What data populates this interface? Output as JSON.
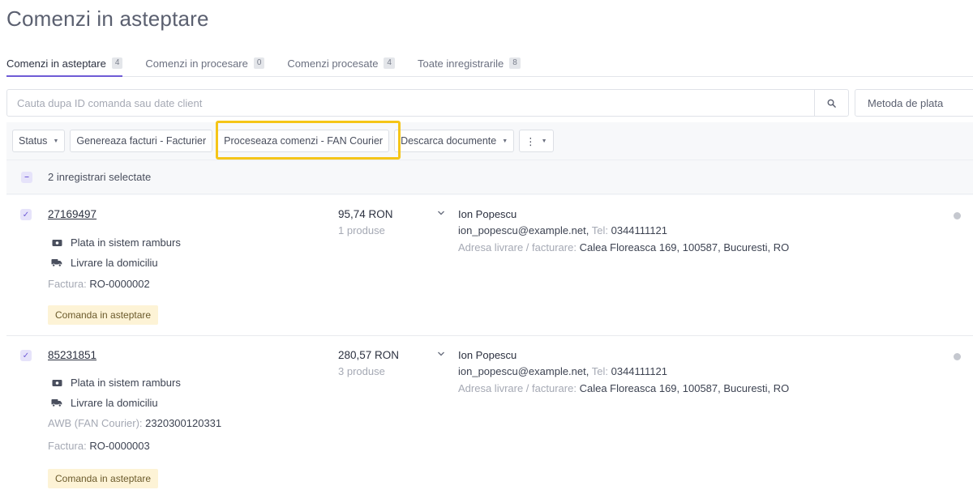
{
  "page": {
    "title": "Comenzi in asteptare"
  },
  "tabs": [
    {
      "label": "Comenzi in asteptare",
      "count": "4"
    },
    {
      "label": "Comenzi in procesare",
      "count": "0"
    },
    {
      "label": "Comenzi procesate",
      "count": "4"
    },
    {
      "label": "Toate inregistrarile",
      "count": "8"
    }
  ],
  "search": {
    "placeholder": "Cauta dupa ID comanda sau date client",
    "value": ""
  },
  "payment_filter": {
    "label": "Metoda de plata"
  },
  "toolbar": {
    "status_label": "Status",
    "generate_invoices_label": "Genereaza facturi - Facturier",
    "process_orders_label": "Proceseaza comenzi - FAN Courier",
    "download_docs_label": "Descarca documente",
    "more_label": "⋮"
  },
  "selection": {
    "text": "2 inregistrari selectate"
  },
  "labels": {
    "invoice": "Factura:",
    "awb": "AWB (FAN Courier):",
    "tel": "Tel:",
    "address": "Adresa livrare / facturare:"
  },
  "orders": [
    {
      "id": "27169497",
      "payment": "Plata in sistem ramburs",
      "delivery": "Livrare la domiciliu",
      "awb": "",
      "invoice": "RO-0000002",
      "status": "Comanda in asteptare",
      "price": "95,74 RON",
      "products": "1 produse",
      "client_name": "Ion Popescu",
      "client_email": "ion_popescu@example.net,",
      "client_phone": "0344111121",
      "client_address": "Calea Floreasca 169, 100587, Bucuresti, RO"
    },
    {
      "id": "85231851",
      "payment": "Plata in sistem ramburs",
      "delivery": "Livrare la domiciliu",
      "awb": "2320300120331",
      "invoice": "RO-0000003",
      "status": "Comanda in asteptare",
      "price": "280,57 RON",
      "products": "3 produse",
      "client_name": "Ion Popescu",
      "client_email": "ion_popescu@example.net,",
      "client_phone": "0344111121",
      "client_address": "Calea Floreasca 169, 100587, Bucuresti, RO"
    }
  ],
  "colors": {
    "accent": "#6f5bd6",
    "highlight": "#f5c518",
    "status_badge_bg": "#fdf3d6",
    "status_dot": "#c5c8cf"
  }
}
